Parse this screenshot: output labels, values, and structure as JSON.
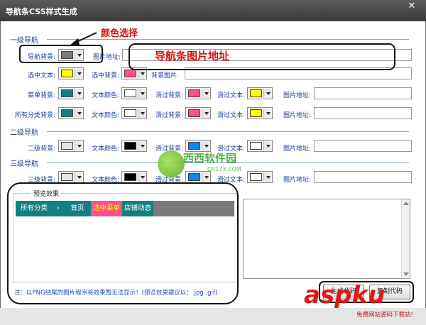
{
  "window": {
    "title": "导航条CSS样式生成",
    "close_glyph": "✕"
  },
  "sections": {
    "level1": "一级导航",
    "level2": "二级导航",
    "level3": "三级导航"
  },
  "level1": {
    "nav_bg_label": "导航背景:",
    "nav_bg_color": "#7a7a7a",
    "nav_img_label": "图片地址:",
    "nav_img_value": "",
    "selected_text_label": "选中文本:",
    "selected_text_color": "#ffff00",
    "selected_bg_label": "选中背景:",
    "selected_bg_color": "#ff4f8a",
    "bg_image_label": "背景图片:",
    "bg_image_value": "",
    "menu_row": {
      "bg_label": "菜单背景:",
      "bg_color": "#138080",
      "text_label": "文本颜色:",
      "text_color": "#ffffff",
      "hover_bg_label": "滑过背景:",
      "hover_bg_color": "#ff4f8a",
      "hover_text_label": "滑过文本:",
      "hover_text_color": "#ffff00",
      "img_label": "图片地址:",
      "img_value": ""
    },
    "all_row": {
      "bg_label": "所有分类背景:",
      "bg_color": "#138080",
      "text_label": "文本颜色:",
      "text_color": "#ffffff",
      "hover_bg_label": "滑过背景:",
      "hover_bg_color": "#ff4f8a",
      "hover_text_label": "滑过文本:",
      "hover_text_color": "#ffff00",
      "img_label": "图片地址:",
      "img_value": ""
    }
  },
  "level2": {
    "bg_label": "二级背景:",
    "bg_color": "#e6e6e6",
    "text_label": "文本颜色:",
    "text_color": "#000000",
    "hover_bg_label": "滑过背景:",
    "hover_bg_color": "#0a84ff",
    "hover_text_label": "滑过文本:",
    "hover_text_color": "#ffffff",
    "img_label": "图片地址:",
    "img_value": ""
  },
  "level3": {
    "bg_label": "三级背景:",
    "bg_color": "#e6e6e6",
    "text_label": "文本颜色:",
    "text_color": "#000000",
    "hover_bg_label": "滑过背景:",
    "hover_bg_color": "#0a84ff",
    "hover_text_label": "滑过文本:",
    "hover_text_color": "#ffffff",
    "img_label": "图片地址:",
    "img_value": ""
  },
  "annotations": {
    "color_select": "颜色选择",
    "nav_image_url": "导航条图片地址",
    "accent_color": "#d41212"
  },
  "preview": {
    "group_label": "预览效果",
    "nav_bg": "#7a7a7a",
    "items": [
      {
        "label": "所有分类",
        "bg": "#138080"
      },
      {
        "label": "›",
        "bg": "#138080"
      },
      {
        "label": "首页",
        "bg": "#138080"
      },
      {
        "label": "选中菜单",
        "bg": "#ff4f8a",
        "text_color": "#ffff00"
      },
      {
        "label": "店铺动态",
        "bg": "#138080"
      }
    ]
  },
  "code_output": {
    "value": ""
  },
  "footer": {
    "hint": "注：以PNG结尾的图片程序将效果暂无法显示！(预览效果建议以：.jpg .gif)",
    "generate_label": "生成代码",
    "copy_label": "复制代码"
  },
  "watermarks": {
    "xixi_text": "西西软件园",
    "xixi_sub": "CR173.COM",
    "aspku_text": "aspku",
    "aspku_sub": "免费网站源码下载站!"
  }
}
